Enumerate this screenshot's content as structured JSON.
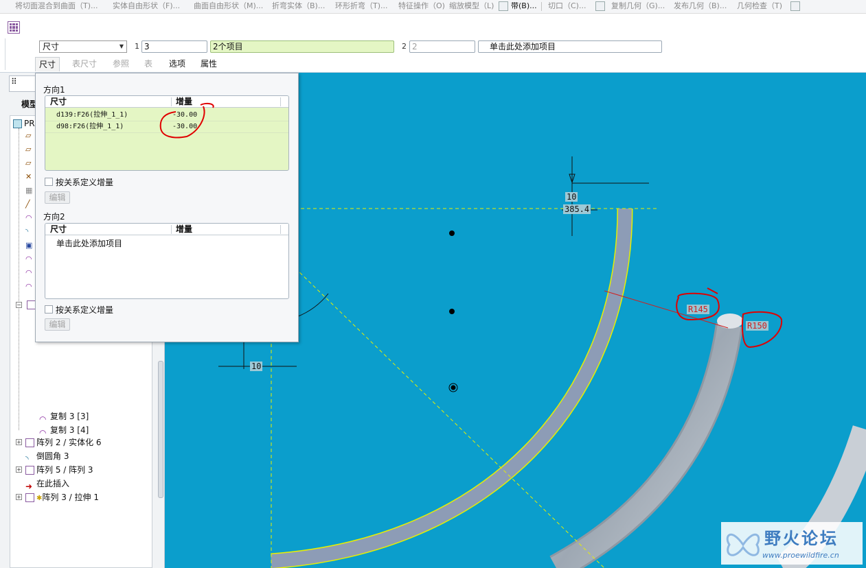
{
  "menubar": {
    "items": [
      {
        "label": "将切面混合到曲面（T)...",
        "dim": true
      },
      {
        "label": "实体自由形状（F)...",
        "dim": true
      },
      {
        "label": "曲面自由形状（M)...",
        "dim": true
      },
      {
        "label": "折弯实体（B)...",
        "dim": true
      },
      {
        "label": "环形折弯（T)...",
        "dim": true
      },
      {
        "label": "特征操作（O)",
        "dim": true
      },
      {
        "label": "缩放模型（L)",
        "dim": true
      },
      {
        "label": "带(B)...",
        "dim": false
      },
      {
        "label": "切口（C)...",
        "dim": true
      },
      {
        "label": "复制几何（G)...",
        "dim": true
      },
      {
        "label": "发布几何（B)...",
        "dim": true
      },
      {
        "label": "几何检查（T)",
        "dim": true
      }
    ]
  },
  "dashboard": {
    "type_dropdown": "尺寸",
    "dir1_number": "1",
    "dir1_count": "3",
    "dir1_items": "2个项目",
    "dir2_number": "2",
    "dir2_count": "2",
    "dir2_items": "单击此处添加项目",
    "tabs": [
      {
        "label": "尺寸",
        "active": true,
        "dim": false
      },
      {
        "label": "表尺寸",
        "active": false,
        "dim": true
      },
      {
        "label": "参照",
        "active": false,
        "dim": true
      },
      {
        "label": "表",
        "active": false,
        "dim": true
      },
      {
        "label": "选项",
        "active": false,
        "dim": false
      },
      {
        "label": "属性",
        "active": false,
        "dim": false
      }
    ]
  },
  "dim_panel": {
    "dir1_title": "方向1",
    "dir2_title": "方向2",
    "col_dim": "尺寸",
    "col_inc": "增量",
    "dir1_rows": [
      {
        "dim": "d139:F26(拉伸_1_1)",
        "inc": "-30.00"
      },
      {
        "dim": "d98:F26(拉伸_1_1)",
        "inc": "-30.00"
      }
    ],
    "dir2_placeholder": "单击此处添加项目",
    "relation_checkbox": "按关系定义增量",
    "edit_button": "编辑"
  },
  "model_tree": {
    "title": "模型",
    "root_label": "PR",
    "items": [
      {
        "label": "复制 3 [3]",
        "icon": "copy-icon"
      },
      {
        "label": "复制 3 [4]",
        "icon": "copy-icon"
      },
      {
        "label": "阵列 2 / 实体化 6",
        "icon": "pattern-icon"
      },
      {
        "label": "倒圆角 3",
        "icon": "round-icon"
      },
      {
        "label": "阵列 5 / 阵列 3",
        "icon": "pattern-icon"
      },
      {
        "label": "在此插入",
        "icon": "insert-arrow-icon"
      },
      {
        "label": "阵列 3 / 拉伸 1",
        "icon": "pattern-icon"
      }
    ]
  },
  "canvas": {
    "dim_top": "10",
    "dim_value": "385.4",
    "dim_left": "10",
    "radius1": "R145",
    "radius2": "R150",
    "colors": {
      "background": "#0b9ecc",
      "annotation": "#e00000",
      "edge": "#e8f000"
    }
  },
  "watermark": {
    "title": "野火论坛",
    "url": "www.proewildfire.cn"
  }
}
